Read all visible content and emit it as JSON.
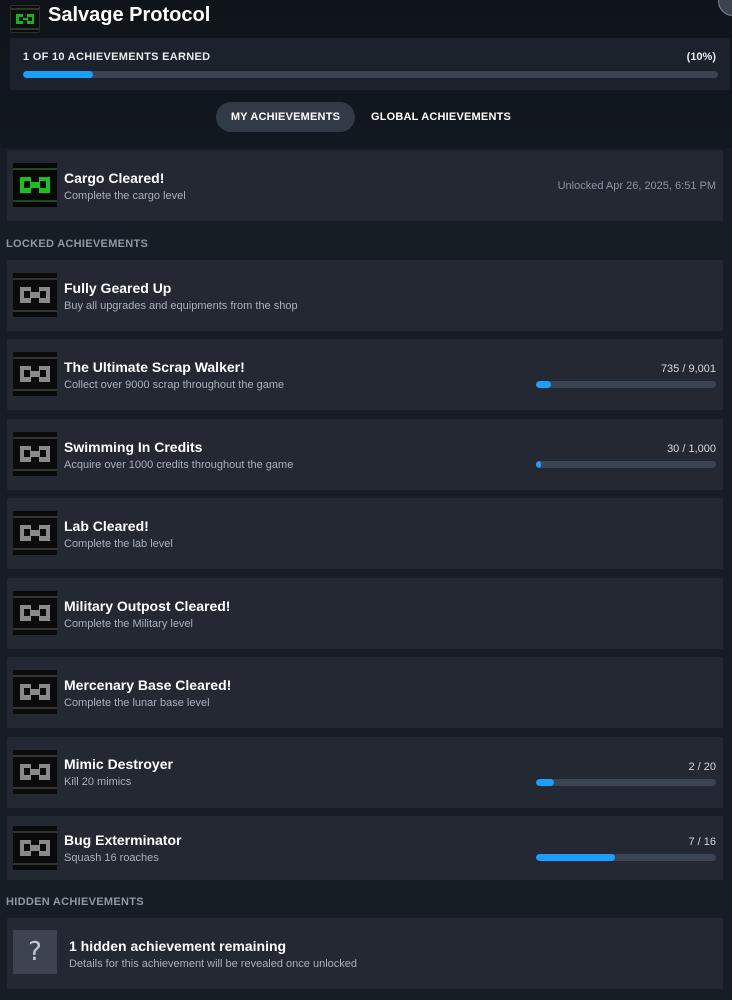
{
  "header": {
    "title": "Salvage Protocol",
    "game_icon": "robot-game-icon"
  },
  "summary": {
    "label": "1 OF 10 ACHIEVEMENTS EARNED",
    "percent_text": "(10%)",
    "progress": 0.1
  },
  "tabs": [
    {
      "label": "MY ACHIEVEMENTS",
      "active": true
    },
    {
      "label": "GLOBAL ACHIEVEMENTS",
      "active": false
    }
  ],
  "unlocked": [
    {
      "name": "Cargo Cleared!",
      "desc": "Complete the cargo level",
      "date": "Unlocked Apr 26, 2025, 6:51 PM"
    }
  ],
  "locked_label": "LOCKED ACHIEVEMENTS",
  "locked": [
    {
      "name": "Fully Geared Up",
      "desc": "Buy all upgrades and equipments from the shop"
    },
    {
      "name": "The Ultimate Scrap Walker!",
      "desc": "Collect over 9000 scrap throughout the game",
      "progress_text": "735 / 9,001",
      "current": 735,
      "total": 9001
    },
    {
      "name": "Swimming In Credits",
      "desc": "Acquire over 1000 credits throughout the game",
      "progress_text": "30 / 1,000",
      "current": 30,
      "total": 1000
    },
    {
      "name": "Lab Cleared!",
      "desc": "Complete the lab level"
    },
    {
      "name": "Military Outpost Cleared!",
      "desc": "Complete the Military level"
    },
    {
      "name": "Mercenary Base Cleared!",
      "desc": "Complete the lunar base level"
    },
    {
      "name": "Mimic Destroyer",
      "desc": "Kill 20 mimics",
      "progress_text": "2 / 20",
      "current": 2,
      "total": 20
    },
    {
      "name": "Bug Exterminator",
      "desc": "Squash 16 roaches",
      "progress_text": "7 / 16",
      "current": 7,
      "total": 16
    }
  ],
  "hidden_label": "HIDDEN ACHIEVEMENTS",
  "hidden": {
    "icon": "?",
    "title": "1 hidden achievement remaining",
    "desc": "Details for this achievement will be revealed once unlocked"
  },
  "colors": {
    "accent": "#1a9fff",
    "background": "#171d25",
    "card": "#232833",
    "unlocked_icon": "#18c21a",
    "locked_icon": "#8a8a8a"
  }
}
